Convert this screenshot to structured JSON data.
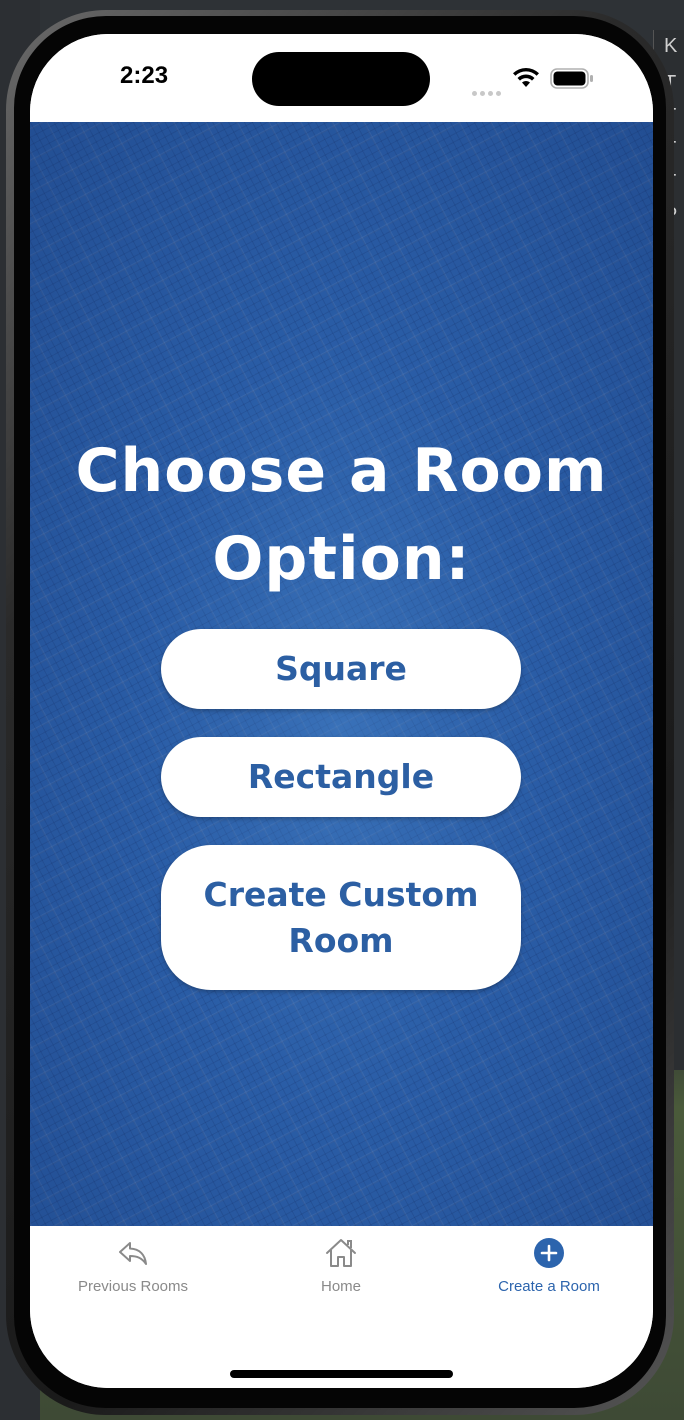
{
  "status_bar": {
    "time": "2:23"
  },
  "main": {
    "heading_line1": "Choose a Room",
    "heading_line2": "Option:",
    "buttons": [
      {
        "label": "Square"
      },
      {
        "label": "Rectangle"
      },
      {
        "label": "Create Custom Room"
      }
    ]
  },
  "tab_bar": {
    "tabs": [
      {
        "label": "Previous Rooms",
        "icon": "reply-arrow-icon",
        "active": false
      },
      {
        "label": "Home",
        "icon": "home-icon",
        "active": false
      },
      {
        "label": "Create a Room",
        "icon": "plus-circle-icon",
        "active": true
      }
    ]
  },
  "background_text": {
    "right_edge": [
      "K",
      "T",
      "T",
      "T",
      "T",
      "P"
    ]
  },
  "colors": {
    "accent": "#2c64ad",
    "background_blue": "#2a5da6",
    "inactive_tab": "#8a8a8a"
  }
}
